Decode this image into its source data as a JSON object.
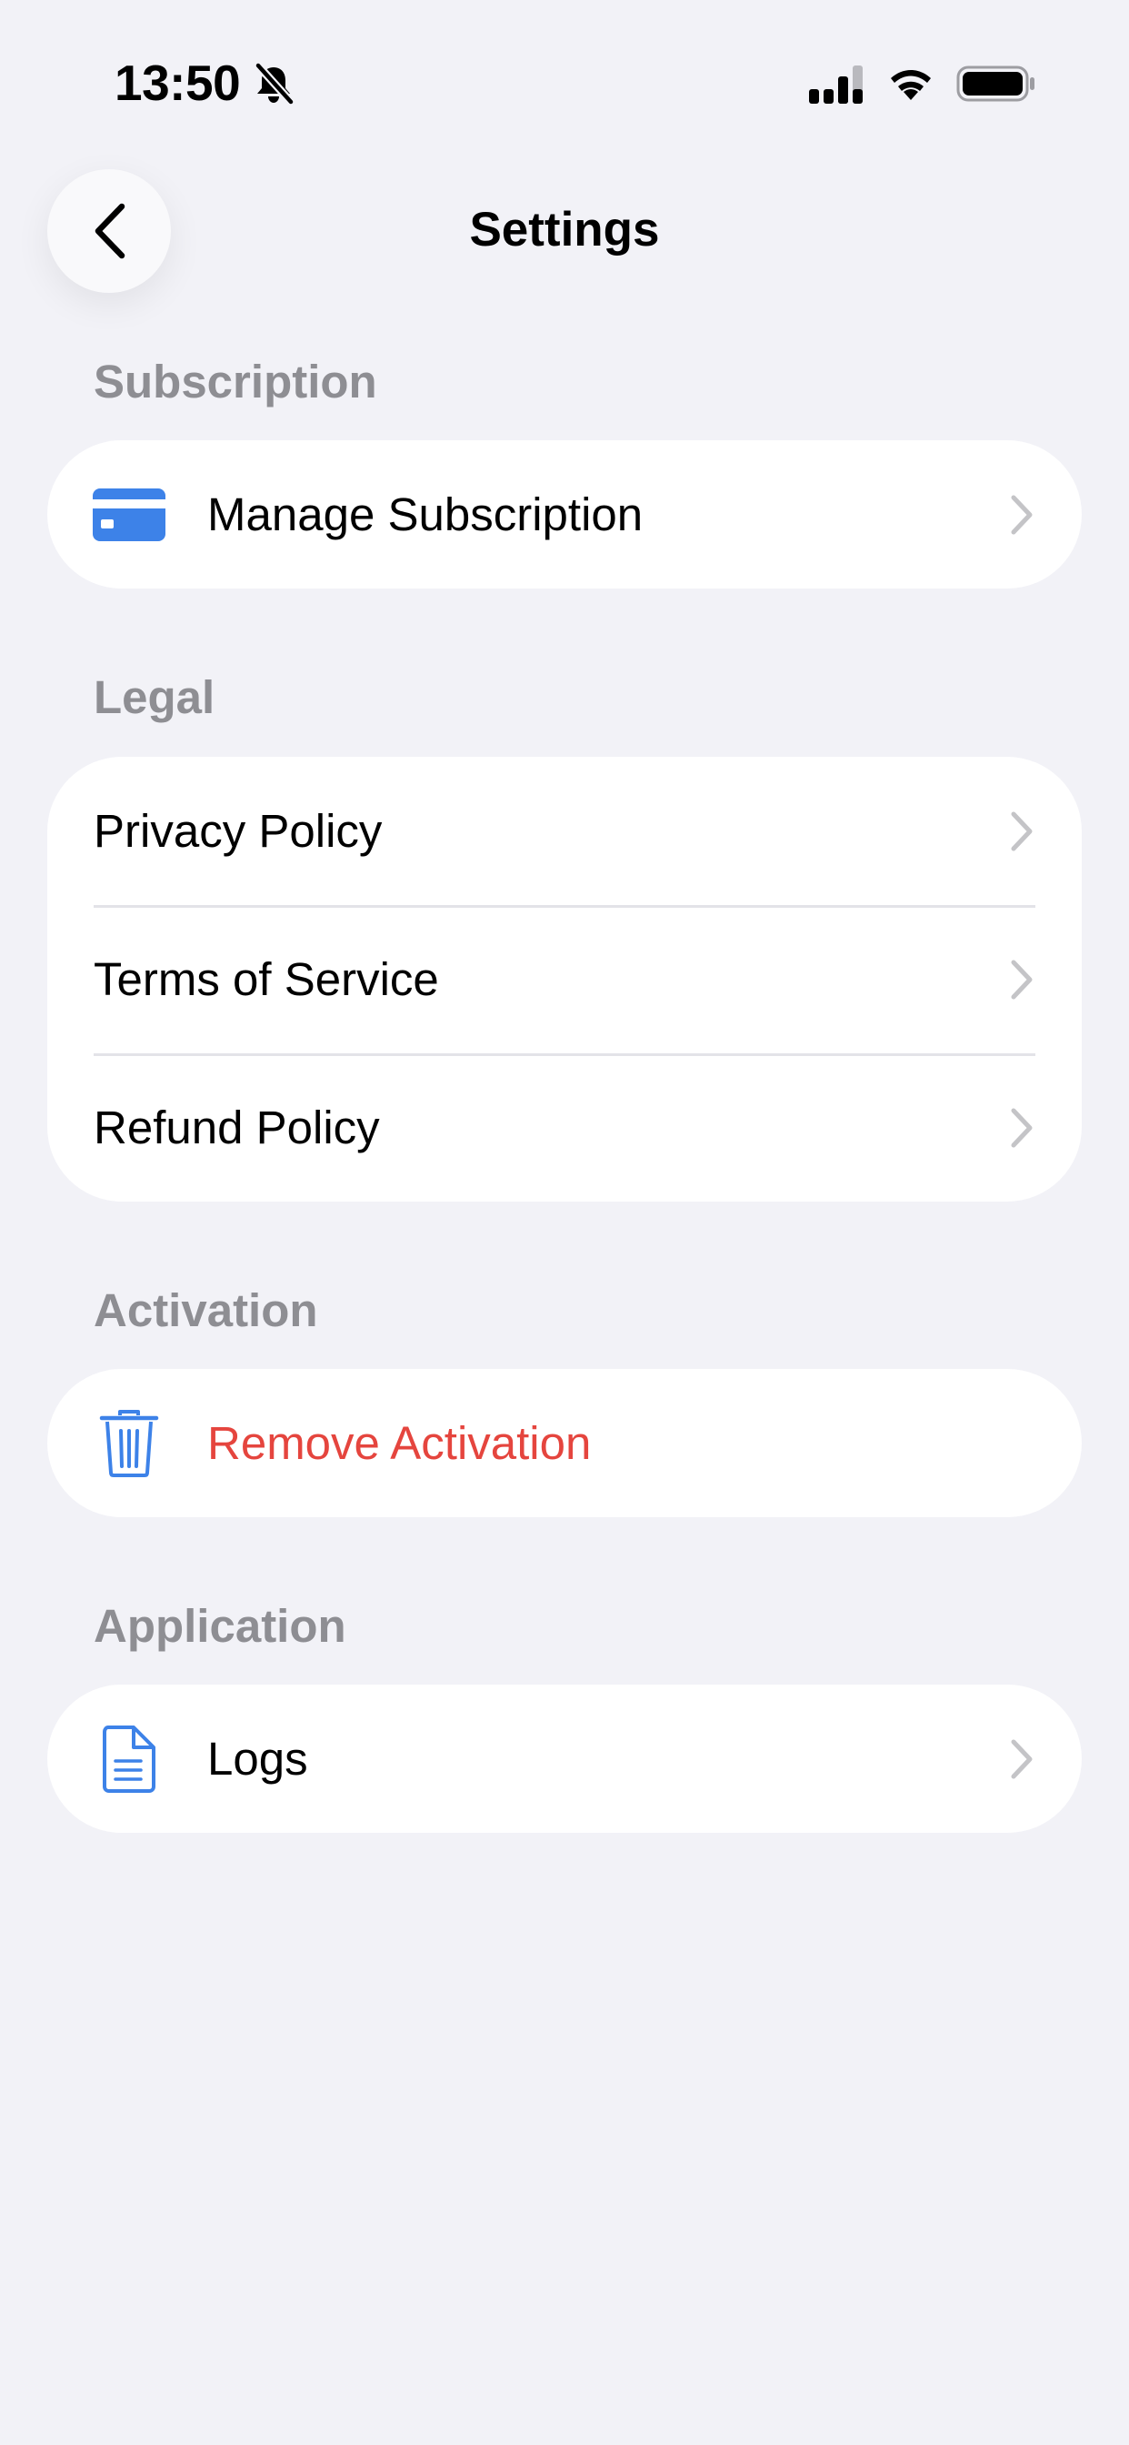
{
  "status_bar": {
    "time": "13:50",
    "icons": [
      "bell-slash-icon",
      "cellular-signal-icon",
      "wifi-icon",
      "battery-icon"
    ]
  },
  "nav": {
    "title": "Settings",
    "back_icon": "chevron-left-icon"
  },
  "sections": [
    {
      "header": "Subscription",
      "rows": [
        {
          "label": "Manage Subscription",
          "icon": "credit-card-icon",
          "chevron": true
        }
      ]
    },
    {
      "header": "Legal",
      "rows": [
        {
          "label": "Privacy Policy",
          "chevron": true
        },
        {
          "label": "Terms of Service",
          "chevron": true
        },
        {
          "label": "Refund Policy",
          "chevron": true
        }
      ]
    },
    {
      "header": "Activation",
      "rows": [
        {
          "label": "Remove Activation",
          "icon": "trash-icon",
          "chevron": false,
          "destructive": true
        }
      ]
    },
    {
      "header": "Application",
      "rows": [
        {
          "label": "Logs",
          "icon": "document-icon",
          "chevron": true
        }
      ]
    }
  ],
  "colors": {
    "background": "#F2F2F7",
    "card": "#FFFFFF",
    "accent": "#3D82E8",
    "destructive": "#E5453E",
    "section_header": "#8E8E93",
    "chevron": "#C4C4C7"
  }
}
